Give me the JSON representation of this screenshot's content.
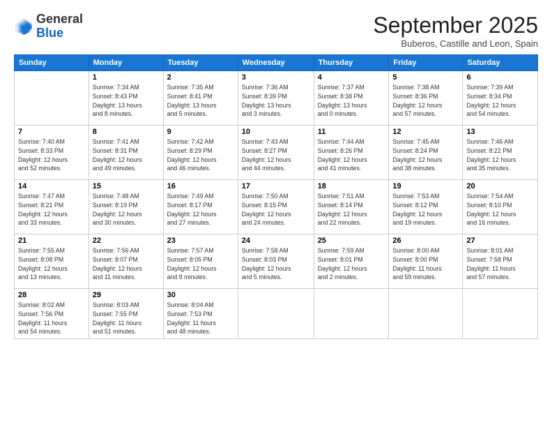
{
  "header": {
    "logo_general": "General",
    "logo_blue": "Blue",
    "month": "September 2025",
    "location": "Buberos, Castille and Leon, Spain"
  },
  "days_of_week": [
    "Sunday",
    "Monday",
    "Tuesday",
    "Wednesday",
    "Thursday",
    "Friday",
    "Saturday"
  ],
  "weeks": [
    [
      {
        "day": "",
        "info": ""
      },
      {
        "day": "1",
        "info": "Sunrise: 7:34 AM\nSunset: 8:43 PM\nDaylight: 13 hours\nand 8 minutes."
      },
      {
        "day": "2",
        "info": "Sunrise: 7:35 AM\nSunset: 8:41 PM\nDaylight: 13 hours\nand 5 minutes."
      },
      {
        "day": "3",
        "info": "Sunrise: 7:36 AM\nSunset: 8:39 PM\nDaylight: 13 hours\nand 3 minutes."
      },
      {
        "day": "4",
        "info": "Sunrise: 7:37 AM\nSunset: 8:38 PM\nDaylight: 13 hours\nand 0 minutes."
      },
      {
        "day": "5",
        "info": "Sunrise: 7:38 AM\nSunset: 8:36 PM\nDaylight: 12 hours\nand 57 minutes."
      },
      {
        "day": "6",
        "info": "Sunrise: 7:39 AM\nSunset: 8:34 PM\nDaylight: 12 hours\nand 54 minutes."
      }
    ],
    [
      {
        "day": "7",
        "info": "Sunrise: 7:40 AM\nSunset: 8:33 PM\nDaylight: 12 hours\nand 52 minutes."
      },
      {
        "day": "8",
        "info": "Sunrise: 7:41 AM\nSunset: 8:31 PM\nDaylight: 12 hours\nand 49 minutes."
      },
      {
        "day": "9",
        "info": "Sunrise: 7:42 AM\nSunset: 8:29 PM\nDaylight: 12 hours\nand 46 minutes."
      },
      {
        "day": "10",
        "info": "Sunrise: 7:43 AM\nSunset: 8:27 PM\nDaylight: 12 hours\nand 44 minutes."
      },
      {
        "day": "11",
        "info": "Sunrise: 7:44 AM\nSunset: 8:26 PM\nDaylight: 12 hours\nand 41 minutes."
      },
      {
        "day": "12",
        "info": "Sunrise: 7:45 AM\nSunset: 8:24 PM\nDaylight: 12 hours\nand 38 minutes."
      },
      {
        "day": "13",
        "info": "Sunrise: 7:46 AM\nSunset: 8:22 PM\nDaylight: 12 hours\nand 35 minutes."
      }
    ],
    [
      {
        "day": "14",
        "info": "Sunrise: 7:47 AM\nSunset: 8:21 PM\nDaylight: 12 hours\nand 33 minutes."
      },
      {
        "day": "15",
        "info": "Sunrise: 7:48 AM\nSunset: 8:19 PM\nDaylight: 12 hours\nand 30 minutes."
      },
      {
        "day": "16",
        "info": "Sunrise: 7:49 AM\nSunset: 8:17 PM\nDaylight: 12 hours\nand 27 minutes."
      },
      {
        "day": "17",
        "info": "Sunrise: 7:50 AM\nSunset: 8:15 PM\nDaylight: 12 hours\nand 24 minutes."
      },
      {
        "day": "18",
        "info": "Sunrise: 7:51 AM\nSunset: 8:14 PM\nDaylight: 12 hours\nand 22 minutes."
      },
      {
        "day": "19",
        "info": "Sunrise: 7:53 AM\nSunset: 8:12 PM\nDaylight: 12 hours\nand 19 minutes."
      },
      {
        "day": "20",
        "info": "Sunrise: 7:54 AM\nSunset: 8:10 PM\nDaylight: 12 hours\nand 16 minutes."
      }
    ],
    [
      {
        "day": "21",
        "info": "Sunrise: 7:55 AM\nSunset: 8:08 PM\nDaylight: 12 hours\nand 13 minutes."
      },
      {
        "day": "22",
        "info": "Sunrise: 7:56 AM\nSunset: 8:07 PM\nDaylight: 12 hours\nand 11 minutes."
      },
      {
        "day": "23",
        "info": "Sunrise: 7:57 AM\nSunset: 8:05 PM\nDaylight: 12 hours\nand 8 minutes."
      },
      {
        "day": "24",
        "info": "Sunrise: 7:58 AM\nSunset: 8:03 PM\nDaylight: 12 hours\nand 5 minutes."
      },
      {
        "day": "25",
        "info": "Sunrise: 7:59 AM\nSunset: 8:01 PM\nDaylight: 12 hours\nand 2 minutes."
      },
      {
        "day": "26",
        "info": "Sunrise: 8:00 AM\nSunset: 8:00 PM\nDaylight: 11 hours\nand 59 minutes."
      },
      {
        "day": "27",
        "info": "Sunrise: 8:01 AM\nSunset: 7:58 PM\nDaylight: 11 hours\nand 57 minutes."
      }
    ],
    [
      {
        "day": "28",
        "info": "Sunrise: 8:02 AM\nSunset: 7:56 PM\nDaylight: 11 hours\nand 54 minutes."
      },
      {
        "day": "29",
        "info": "Sunrise: 8:03 AM\nSunset: 7:55 PM\nDaylight: 11 hours\nand 51 minutes."
      },
      {
        "day": "30",
        "info": "Sunrise: 8:04 AM\nSunset: 7:53 PM\nDaylight: 11 hours\nand 48 minutes."
      },
      {
        "day": "",
        "info": ""
      },
      {
        "day": "",
        "info": ""
      },
      {
        "day": "",
        "info": ""
      },
      {
        "day": "",
        "info": ""
      }
    ]
  ]
}
